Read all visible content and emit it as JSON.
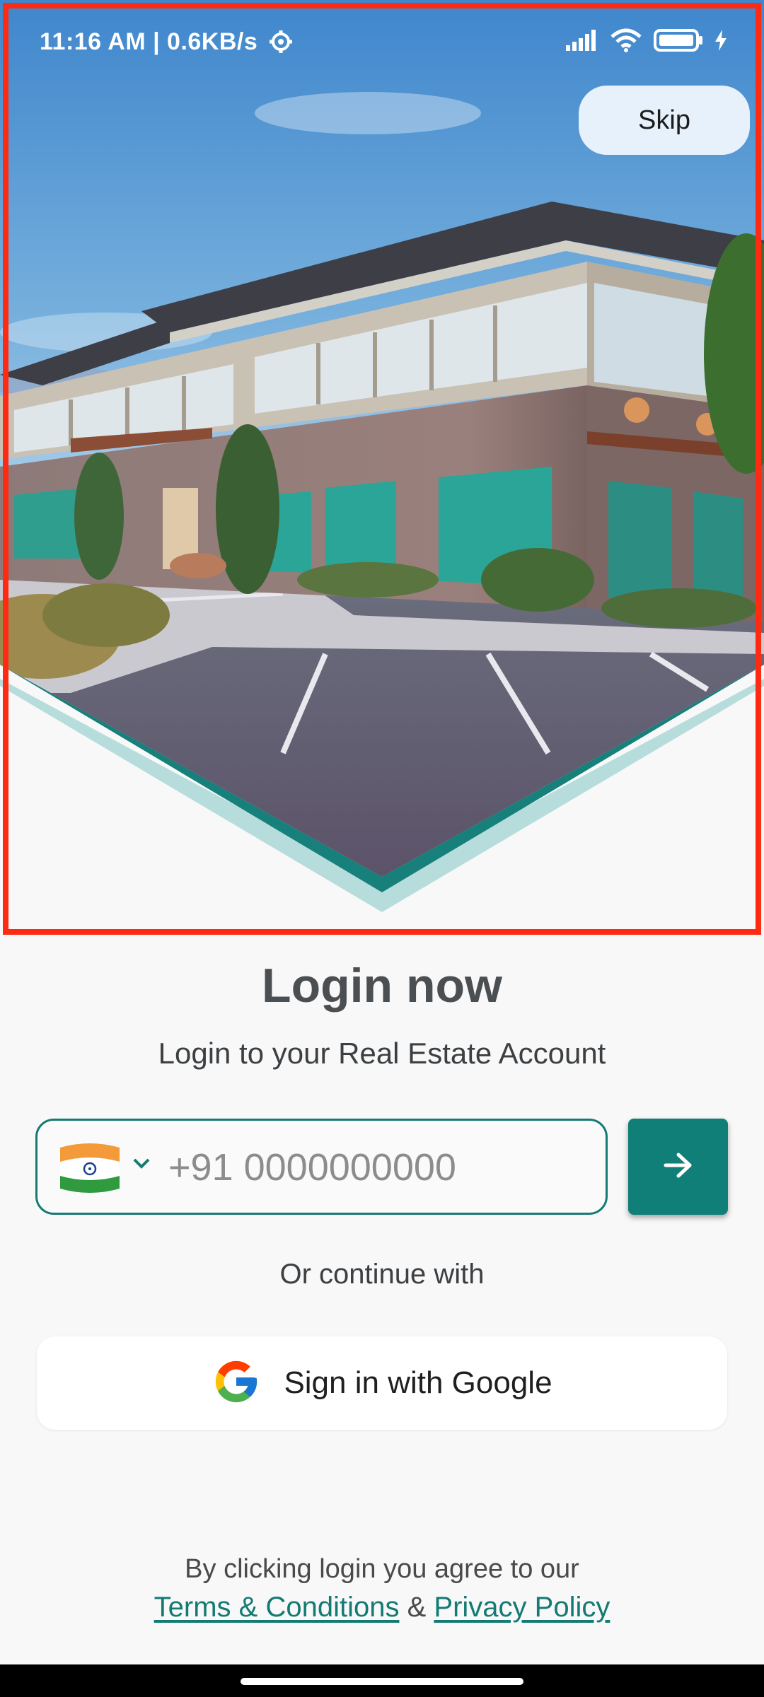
{
  "status_bar": {
    "time_speed": "11:16 AM | 0.6KB/s",
    "icons": [
      "gear-icon",
      "signal-icon",
      "wifi-icon",
      "battery-icon",
      "charging-icon"
    ]
  },
  "skip": {
    "label": "Skip"
  },
  "login": {
    "title": "Login now",
    "subtitle": "Login to your Real Estate Account",
    "phone_placeholder": "+91 0000000000",
    "country_flag": "india-flag-icon",
    "or_continue": "Or continue with",
    "google_label": "Sign in with Google"
  },
  "terms": {
    "line1": "By clicking login you agree to our",
    "terms_link": "Terms & Conditions",
    "amp": "&",
    "privacy_link": "Privacy Policy"
  },
  "colors": {
    "accent_teal": "#0f7f78",
    "highlight_frame": "#ff2a12",
    "background": "#f8f8f8"
  }
}
